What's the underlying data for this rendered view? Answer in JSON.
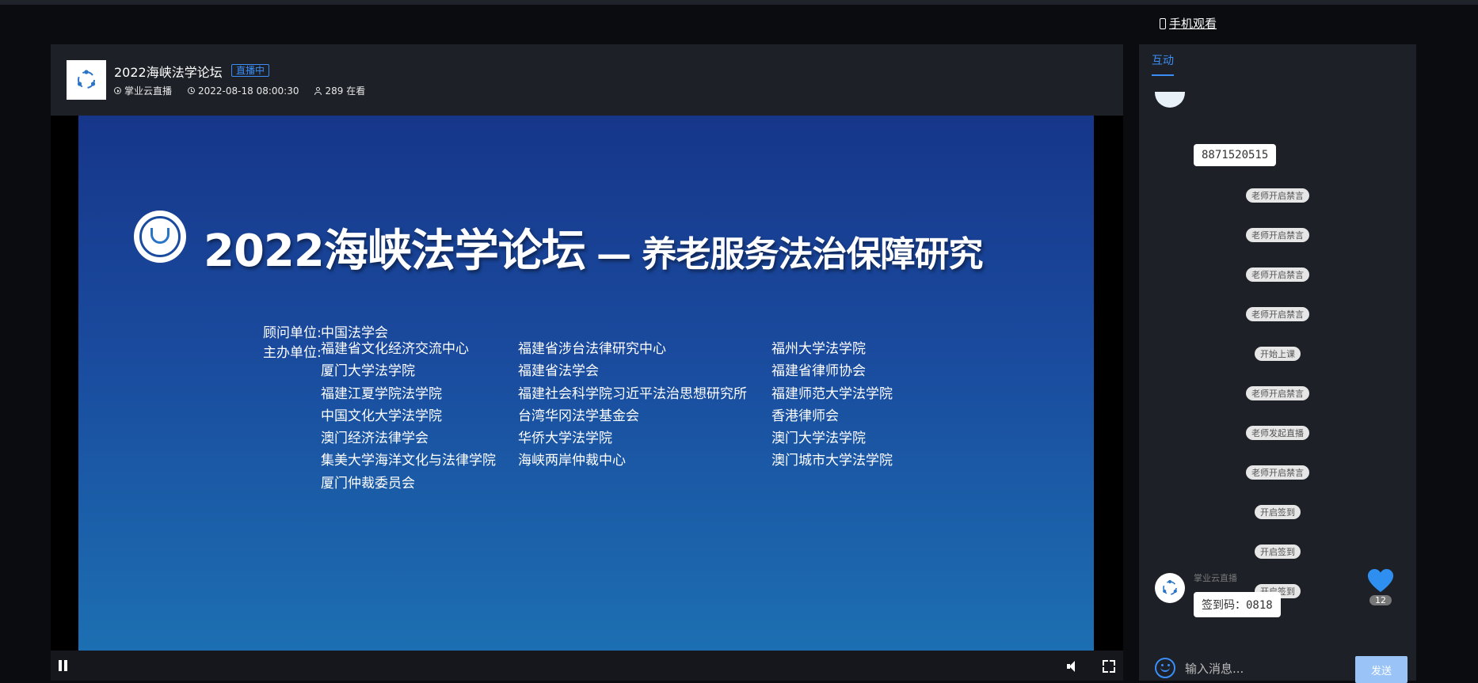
{
  "header": {
    "mobile_view_label": "手机观看"
  },
  "live": {
    "title": "2022海峡法学论坛",
    "status_badge": "直播中",
    "channel": "掌业云直播",
    "datetime": "2022-08-18 08:00:30",
    "viewers": "289 在看"
  },
  "slide": {
    "title_main": "2022海峡法学论坛",
    "title_sub": " — 养老服务法治保障研究",
    "advisor_label": "顾问单位:",
    "advisor": "中国法学会",
    "host_label": "主办单位:",
    "host_col1": [
      "福建省文化经济交流中心",
      "厦门大学法学院",
      "福建江夏学院法学院",
      "中国文化大学法学院",
      "澳门经济法律学会",
      "集美大学海洋文化与法律学院",
      "厦门仲裁委员会"
    ],
    "host_col2": [
      "福建省涉台法律研究中心",
      "福建省法学会",
      "福建社会科学院习近平法治思想研究所",
      "台湾华冈法学基金会",
      "华侨大学法学院",
      "海峡两岸仲裁中心"
    ],
    "host_col3": [
      "福州大学法学院",
      "福建省律师协会",
      "福建师范大学法学院",
      "香港律师会",
      "澳门大学法学院",
      "澳门城市大学法学院"
    ]
  },
  "panel": {
    "tab_label": "互动",
    "messages": {
      "top_bubble": "8871520515",
      "system": [
        "老师开启禁言",
        "老师开启禁言",
        "老师开启禁言",
        "老师开启禁言",
        "开始上课",
        "老师开启禁言",
        "老师发起直播",
        "老师开启禁言",
        "开启签到",
        "开启签到",
        "开启签到"
      ],
      "last_sender": "掌业云直播",
      "last_bubble": "签到码：0818"
    },
    "likes": "12",
    "input_placeholder": "输入消息...",
    "send_label": "发送"
  },
  "colors": {
    "accent": "#3a8ef6",
    "panel_bg": "#1d2027",
    "page_bg": "#0b0c10"
  }
}
